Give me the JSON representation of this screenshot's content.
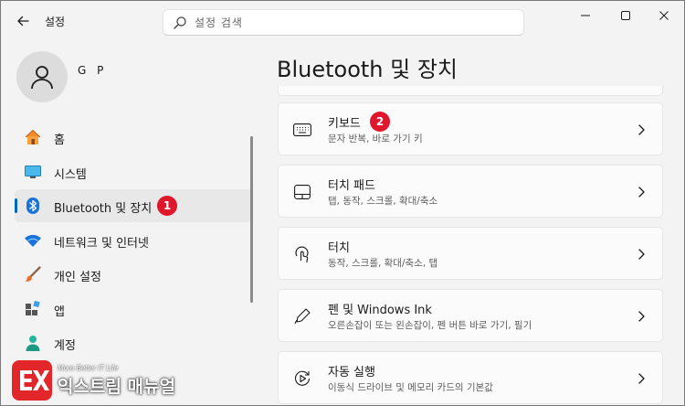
{
  "window": {
    "title": "설정"
  },
  "search": {
    "placeholder": "설정 검색"
  },
  "profile": {
    "name": "G P"
  },
  "nav": {
    "items": [
      {
        "label": "홈",
        "icon": "home-icon"
      },
      {
        "label": "시스템",
        "icon": "system-monitor-icon"
      },
      {
        "label": "Bluetooth 및 장치",
        "icon": "bluetooth-icon",
        "active": true,
        "badge": "1"
      },
      {
        "label": "네트워크 및 인터넷",
        "icon": "wifi-icon"
      },
      {
        "label": "개인 설정",
        "icon": "paintbrush-icon"
      },
      {
        "label": "앱",
        "icon": "apps-icon"
      },
      {
        "label": "계정",
        "icon": "account-icon"
      }
    ]
  },
  "main": {
    "title": "Bluetooth 및 장치",
    "cards": [
      {
        "title": "키보드",
        "subtitle": "문자 반복, 바로 가기 키",
        "icon": "keyboard-icon",
        "badge": "2"
      },
      {
        "title": "터치 패드",
        "subtitle": "탭, 동작, 스크롤, 확대/축소",
        "icon": "touchpad-icon"
      },
      {
        "title": "터치",
        "subtitle": "동작, 스크롤, 확대/축소, 탭",
        "icon": "touch-icon"
      },
      {
        "title": "펜 및 Windows Ink",
        "subtitle": "오른손잡이 또는 왼손잡이, 펜 버튼 바로 가기, 필기",
        "icon": "pen-icon"
      },
      {
        "title": "자동 실행",
        "subtitle": "이동식 드라이브 및 메모리 카드의 기본값",
        "icon": "autoplay-icon"
      }
    ]
  },
  "watermark": {
    "tagline": "More Better IT Life",
    "name": "익스트림 매뉴얼",
    "logo_text": "EX"
  },
  "colors": {
    "accent": "#0067c0",
    "badge": "#e0162b",
    "watermark_logo": "#e3262a"
  }
}
